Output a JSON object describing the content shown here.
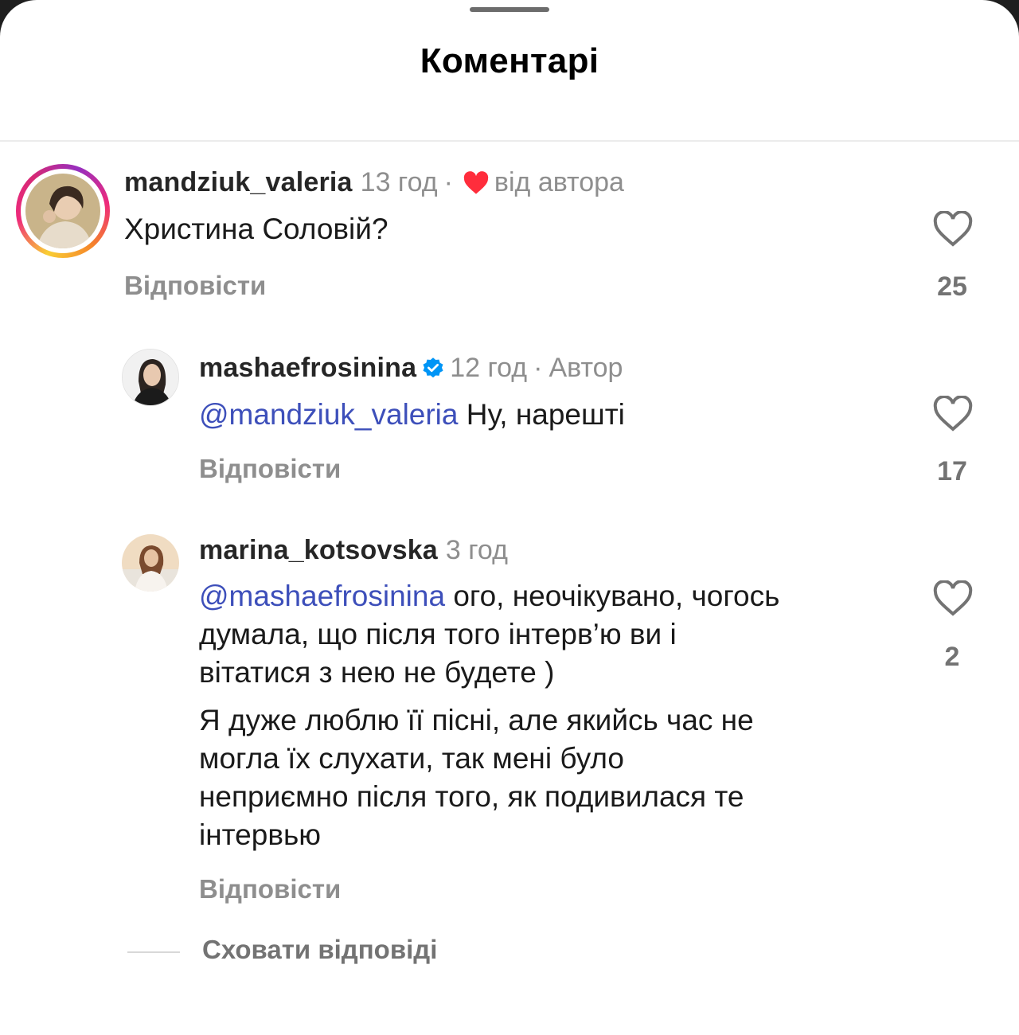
{
  "sheet": {
    "title": "Коментарі"
  },
  "comments": [
    {
      "username": "mandziuk_valeria",
      "time": "13 год",
      "liked_by_author_label": "від автора",
      "text": "Христина Соловій?",
      "reply_label": "Відповісти",
      "likes": "25",
      "has_story_ring": true,
      "avatar_icon": "user-avatar"
    },
    {
      "username": "mashaefrosinina",
      "verified": true,
      "time": "12 год",
      "author_label": "Автор",
      "mention": "@mandziuk_valeria",
      "text": "Ну, нарешті",
      "reply_label": "Відповісти",
      "likes": "17",
      "avatar_icon": "user-avatar"
    },
    {
      "username": "marina_kotsovska",
      "time": "3 год",
      "mention": "@mashaefrosinina",
      "text_line1": "ого, неочікувано, чогось",
      "text_line2": "думала, що після того інтерв’ю ви і",
      "text_line3": "вітатися з нею не будете )",
      "text2_line1": "Я дуже люблю її пісні, але якийсь час не",
      "text2_line2": "могла їх слухати, так мені було",
      "text2_line3": "неприємно після того, як подивилася те",
      "text2_line4": "інтервью",
      "reply_label": "Відповісти",
      "likes": "2",
      "avatar_icon": "user-avatar"
    }
  ],
  "hide_replies_label": "Сховати відповіді",
  "colors": {
    "mention": "#3d4fba",
    "secondary_text": "#8e8e8e",
    "heart_red": "#ff2d3c",
    "verified_blue": "#0095f6"
  }
}
